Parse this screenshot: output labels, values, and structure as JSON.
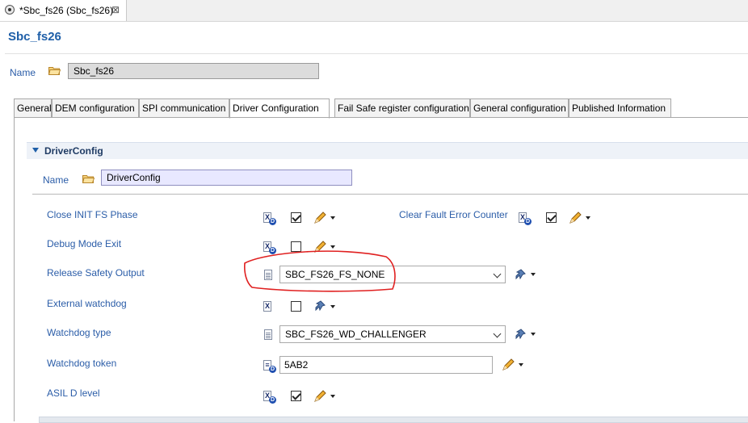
{
  "editor_tab": {
    "label": "*Sbc_fs26 (Sbc_fs26)",
    "close": "⊠"
  },
  "page_title": "Sbc_fs26",
  "name_row": {
    "label": "Name",
    "value": "Sbc_fs26"
  },
  "tabs": [
    {
      "label": "General"
    },
    {
      "label": "DEM configuration"
    },
    {
      "label": "SPI communication"
    },
    {
      "label": "Driver Configuration",
      "active": true
    },
    {
      "label": "Fail Safe register configuration"
    },
    {
      "label": "General configuration"
    },
    {
      "label": "Published Information"
    }
  ],
  "section": {
    "title": "DriverConfig",
    "name_label": "Name",
    "name_value": "DriverConfig"
  },
  "fields": {
    "close_init": {
      "label": "Close INIT FS Phase",
      "checked": true
    },
    "clear_fault": {
      "label": "Clear Fault Error Counter",
      "checked": true
    },
    "debug_mode": {
      "label": "Debug Mode Exit",
      "checked": false
    },
    "release_safety": {
      "label": "Release Safety Output",
      "value": "SBC_FS26_FS_NONE"
    },
    "external_wd": {
      "label": "External watchdog",
      "checked": false
    },
    "wd_type": {
      "label": "Watchdog type",
      "value": "SBC_FS26_WD_CHALLENGER"
    },
    "wd_token": {
      "label": "Watchdog token",
      "value": "5AB2"
    },
    "asil_d": {
      "label": "ASIL D level",
      "checked": true
    }
  },
  "colors": {
    "link": "#2b5da8",
    "title": "#1f5fa8",
    "annotation": "#e02020"
  },
  "icons": [
    "editor-file-icon",
    "folder-icon",
    "doc-icon",
    "xd-icon",
    "pencil-icon",
    "link-icon",
    "dropdown-caret-icon"
  ]
}
